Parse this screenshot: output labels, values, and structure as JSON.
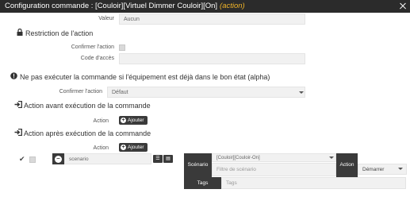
{
  "window": {
    "title": "Configuration commande : [Couloir][Virtuel Dimmer Couloir][On]",
    "title_tag": "(action)"
  },
  "value_row": {
    "label": "Valeur",
    "value": "Aucun"
  },
  "restriction": {
    "heading": "Restriction de l'action",
    "confirm_label": "Confirmer l'action",
    "code_label": "Code d'accès",
    "code_value": ""
  },
  "alpha": {
    "heading": "Ne pas exécuter la commande si l'équipement est déjà dans le bon état (alpha)",
    "label": "Confirmer l'action",
    "value": "Défaut"
  },
  "before": {
    "heading": "Action avant exécution de la commande",
    "action_label": "Action",
    "add_label": "Ajouter"
  },
  "after": {
    "heading": "Action après exécution de la commande",
    "action_label": "Action",
    "add_label": "Ajouter",
    "item": {
      "type_value": "scenario",
      "scenario_label": "Scénario",
      "scenario_value": "[Couloir][Couloir-On]",
      "scenario_filter_placeholder": "Filtre de scénario",
      "action_label": "Action",
      "action_value": "Démarrer",
      "tags_label": "Tags",
      "tags_placeholder": "Tags"
    }
  },
  "colors": {
    "titlebar": "#2b2b2b",
    "title_tag": "#f0b429",
    "dark_button": "#3a3a3a",
    "field_bg": "#f1f1f1"
  },
  "icons": {
    "restriction": "lock-icon",
    "alpha": "warning-icon",
    "before": "sign-in-icon",
    "after": "sign-in-icon"
  }
}
